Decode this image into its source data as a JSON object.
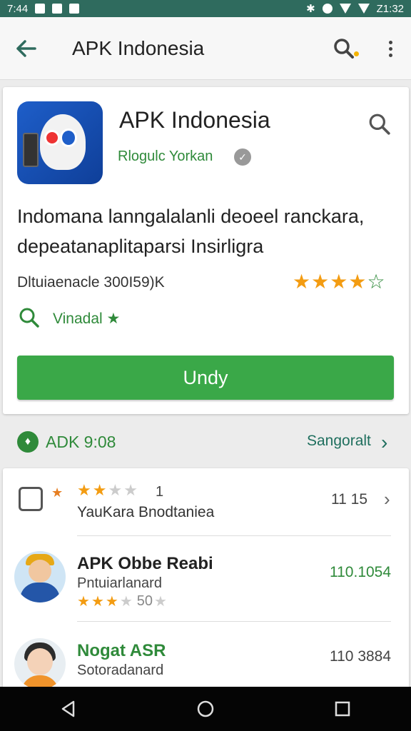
{
  "status_bar": {
    "time": "7:44",
    "right_time": "Z1:32"
  },
  "app_bar": {
    "title": "APK Indonesia"
  },
  "app": {
    "name": "APK Indonesia",
    "developer": "Rlogulc Yorkan",
    "description": "Indomana lanngalalanli deoeel ranckara, depeatanaplitaparsi Insirligra",
    "downloads": "Dltuiaenacle 300I59)K",
    "rating_full": 4,
    "verified_label": "Vinadal",
    "install_label": "Undy"
  },
  "section": {
    "title": "ADK 9:08",
    "see_more": "Sangoralt"
  },
  "list": {
    "review": {
      "count": "1",
      "subtitle": "YauKara Bnodtaniea",
      "meta": "11 15"
    },
    "items": [
      {
        "title": "APK Obbe Reabi",
        "subtitle": "Pntuiarlanard",
        "price": "110.1054",
        "rating_count": "50"
      },
      {
        "title": "Nogat ASR",
        "subtitle": "Sotoradanard",
        "price": "110 3884"
      }
    ]
  },
  "colors": {
    "accent_green": "#3aa848",
    "status_bar": "#2f6b5e",
    "star": "#f39c12"
  },
  "icons": [
    "back-arrow-icon",
    "search-icon",
    "more-vert-icon",
    "verified-icon",
    "chevron-right-icon",
    "back-triangle-icon",
    "home-circle-icon",
    "recents-square-icon"
  ]
}
